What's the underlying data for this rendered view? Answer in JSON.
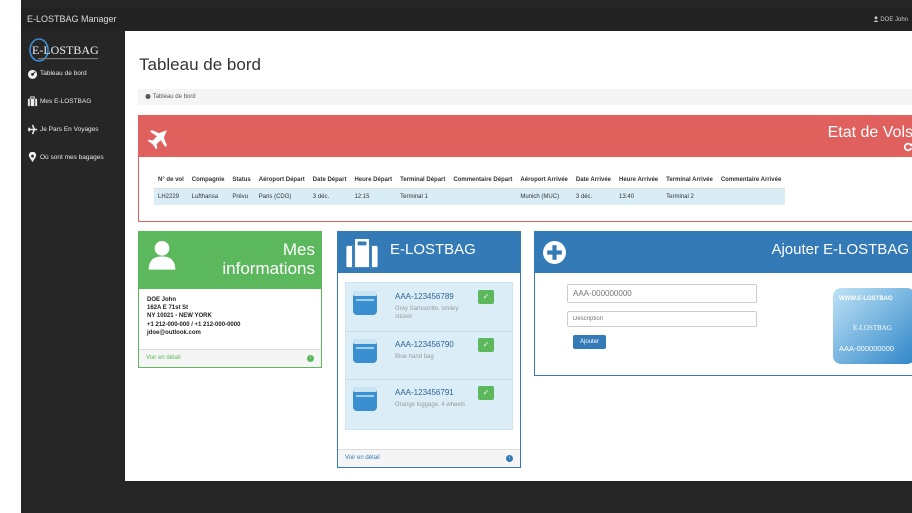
{
  "app": {
    "title": "E-LOSTBAG Manager",
    "user": "DOE John"
  },
  "logo": {
    "text": "E-LOSTBAG"
  },
  "sidebar": {
    "items": [
      {
        "label": "Tableau de bord",
        "icon": "dashboard-icon"
      },
      {
        "label": "Mes E-LOSTBAG",
        "icon": "suitcase-icon"
      },
      {
        "label": "Je Pars En Voyages",
        "icon": "plane-icon"
      },
      {
        "label": "Où sont mes bagages",
        "icon": "map-marker-icon"
      }
    ]
  },
  "page": {
    "title": "Tableau de bord",
    "breadcrumb": "Tableau de bord"
  },
  "flights": {
    "title": "Etat de Vols",
    "headers": [
      "N° de vol",
      "Compagnie",
      "Status",
      "Aéroport Départ",
      "Date Départ",
      "Heure Départ",
      "Terminal Départ",
      "Commentaire Départ",
      "Aéroport Arrivée",
      "Date Arrivée",
      "Heure Arrivée",
      "Terminal Arrivée",
      "Commentaire Arrivée"
    ],
    "rows": [
      [
        "LH2229",
        "Lufthansa",
        "Prévu",
        "Paris (CDG)",
        "3 déc.",
        "12:15",
        "Terminal 1",
        "",
        "Munich (MUC)",
        "3 déc.",
        "13:40",
        "Terminal 2",
        ""
      ]
    ]
  },
  "info": {
    "title_line1": "Mes",
    "title_line2": "informations",
    "name": "DOE John",
    "address1": "162A E 71st St",
    "address2": "NY 10021 - NEW YORK",
    "phone": "+1 212-000-000 / +1 212-000-0000",
    "email": "jdoe@outlook.com",
    "footer": "Voir en détail"
  },
  "lostbag": {
    "title": "E-LOSTBAG",
    "items": [
      {
        "code": "AAA-123456789",
        "desc": "Grey Samsonite, smiley sticker"
      },
      {
        "code": "AAA-123456790",
        "desc": "Blue hand bag"
      },
      {
        "code": "AAA-123456791",
        "desc": "Orange luggage, 4 wheels"
      }
    ],
    "footer": "Voir en détail"
  },
  "add": {
    "title": "Ajouter E-LOSTBAG",
    "code_placeholder": "AAA-000000000",
    "desc_placeholder": "Description",
    "button": "Ajouter",
    "card_brand": "WWW.E-LOSTBAG",
    "card_logo": "E-LOSTBAG",
    "card_code": "AAA-000000000"
  },
  "colors": {
    "red": "#e0605e",
    "green": "#5cb85c",
    "blue": "#337ab7",
    "dark": "#222222"
  }
}
